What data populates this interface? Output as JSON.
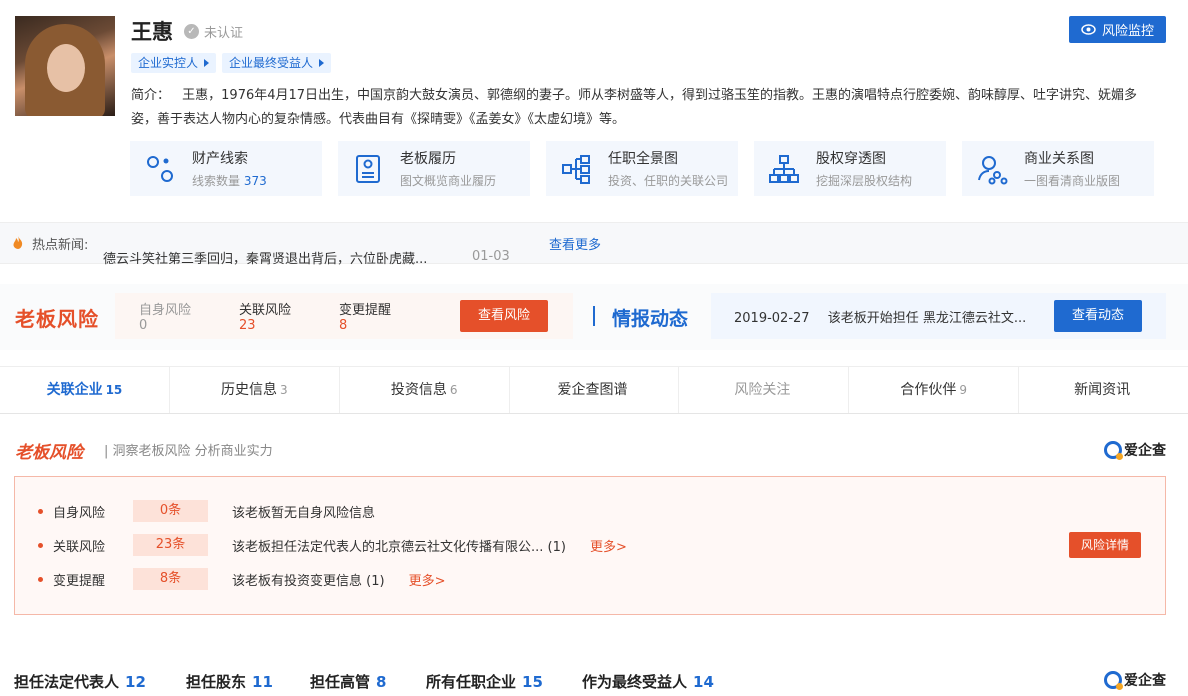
{
  "person": {
    "name": "王惠",
    "verify_status": "未认证",
    "tags": [
      "企业实控人",
      "企业最终受益人"
    ],
    "intro_label": "简介：",
    "intro_text": "王惠，1976年4月17日出生，中国京韵大鼓女演员、郭德纲的妻子。师从李树盛等人，得到过骆玉笙的指教。王惠的演唱特点行腔委婉、韵味醇厚、吐字讲究、妩媚多姿，善于表达人物内心的复杂情感。代表曲目有《探晴雯》《孟姜女》《太虚幻境》等。"
  },
  "monitor_button": "风险监控",
  "cards": [
    {
      "title": "财产线索",
      "sub": "线索数量",
      "count": "373",
      "icon": "clue-icon"
    },
    {
      "title": "老板履历",
      "sub": "图文概览商业履历",
      "icon": "resume-icon"
    },
    {
      "title": "任职全景图",
      "sub": "投资、任职的关联公司",
      "icon": "org-tree-icon"
    },
    {
      "title": "股权穿透图",
      "sub": "挖掘深层股权结构",
      "icon": "equity-icon"
    },
    {
      "title": "商业关系图",
      "sub": "一图看清商业版图",
      "icon": "relation-icon"
    }
  ],
  "news": {
    "label": "热点新闻:",
    "title": "德云斗笑社第三季回归，秦霄贤退出背后，六位卧虎藏...",
    "date": "01-03",
    "more": "查看更多"
  },
  "boss_risk": {
    "title": "老板风险",
    "items": [
      {
        "label": "自身风险",
        "value": "0"
      },
      {
        "label": "关联风险",
        "value": "23"
      },
      {
        "label": "变更提醒",
        "value": "8"
      }
    ],
    "button": "查看风险"
  },
  "intel": {
    "title": "情报动态",
    "date": "2019-02-27",
    "text": "该老板开始担任 黑龙江德云社文...",
    "button": "查看动态"
  },
  "tabs": [
    {
      "label": "关联企业",
      "count": "15"
    },
    {
      "label": "历史信息",
      "count": "3"
    },
    {
      "label": "投资信息",
      "count": "6"
    },
    {
      "label": "爱企查图谱",
      "count": ""
    },
    {
      "label": "风险关注",
      "count": ""
    },
    {
      "label": "合作伙伴",
      "count": "9"
    },
    {
      "label": "新闻资讯",
      "count": ""
    }
  ],
  "risk_section": {
    "title": "老板风险",
    "subtitle": "| 洞察老板风险 分析商业实力",
    "logo": "爱企查",
    "rows": [
      {
        "name": "自身风险",
        "count": "0条",
        "desc": "该老板暂无自身风险信息",
        "more": ""
      },
      {
        "name": "关联风险",
        "count": "23条",
        "desc": "该老板担任法定代表人的北京德云社文化传播有限公...  (1)",
        "more": "更多>"
      },
      {
        "name": "变更提醒",
        "count": "8条",
        "desc": "该老板有投资变更信息 (1)",
        "more": "更多>"
      }
    ],
    "detail_button": "风险详情"
  },
  "bottom_stats": [
    {
      "label": "担任法定代表人",
      "value": "12"
    },
    {
      "label": "担任股东",
      "value": "11"
    },
    {
      "label": "担任高管",
      "value": "8"
    },
    {
      "label": "所有任职企业",
      "value": "15"
    },
    {
      "label": "作为最终受益人",
      "value": "14"
    }
  ],
  "bottom_logo": "爱企查",
  "colors": {
    "brand_blue": "#1f6ad0",
    "risk_red": "#e5502a"
  }
}
